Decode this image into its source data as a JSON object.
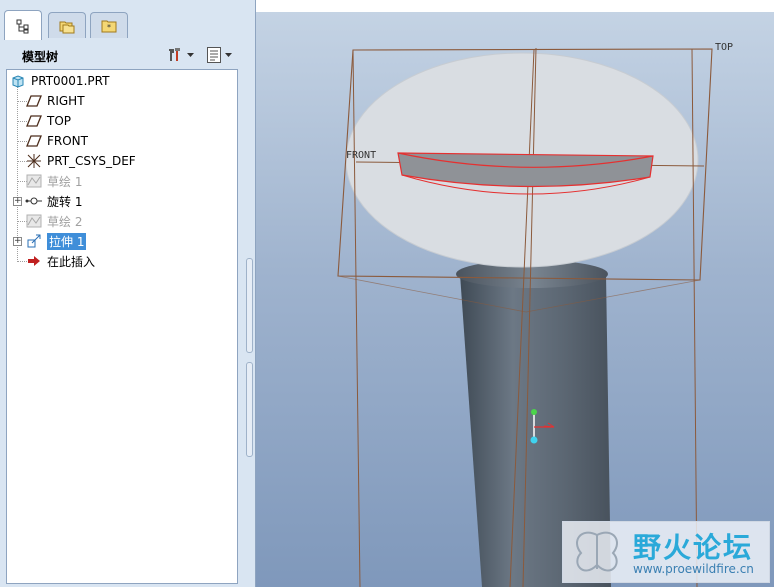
{
  "tabs": [
    {
      "name": "model-tree-tab-icon",
      "active": true
    },
    {
      "name": "folder-browser-tab-icon",
      "active": false
    },
    {
      "name": "favorites-tab-icon",
      "active": false
    }
  ],
  "model_tree": {
    "title": "模型树",
    "items": [
      {
        "label": "PRT0001.PRT",
        "icon": "part-icon"
      },
      {
        "label": "RIGHT",
        "icon": "datum-plane-icon"
      },
      {
        "label": "TOP",
        "icon": "datum-plane-icon"
      },
      {
        "label": "FRONT",
        "icon": "datum-plane-icon"
      },
      {
        "label": "PRT_CSYS_DEF",
        "icon": "csys-icon"
      },
      {
        "label": "草绘 1",
        "icon": "sketch-icon"
      },
      {
        "label": "旋转 1",
        "icon": "revolve-icon"
      },
      {
        "label": "草绘 2",
        "icon": "sketch-icon"
      },
      {
        "label": "拉伸 1",
        "icon": "extrude-icon"
      },
      {
        "label": "在此插入",
        "icon": "insert-here-arrow-icon"
      }
    ]
  },
  "viewport": {
    "datum_labels": {
      "top": "TOP",
      "front": "FRONT"
    }
  },
  "watermark": {
    "title": "野火论坛",
    "url": "www.proewildfire.cn"
  },
  "colors": {
    "selection": "#3f8ed9",
    "datum_plane": "#8b5a3c",
    "sketch_highlight": "#e53030"
  }
}
